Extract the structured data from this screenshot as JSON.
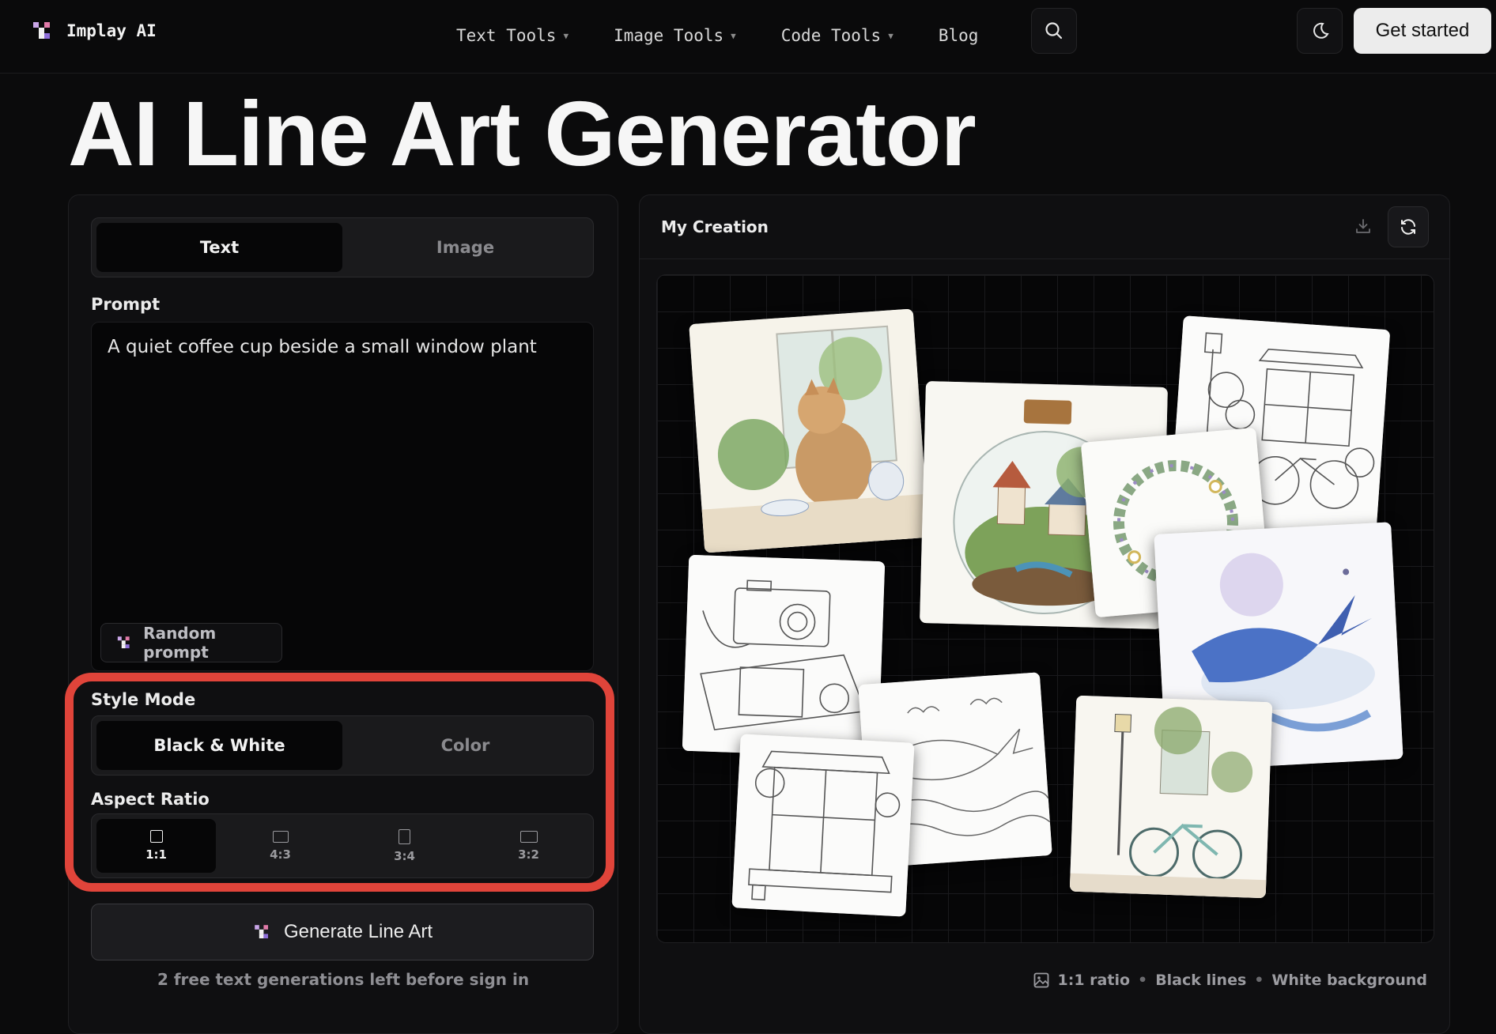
{
  "nav": {
    "brand": "Implay AI",
    "links": [
      {
        "label": "Text Tools",
        "dropdown": true
      },
      {
        "label": "Image Tools",
        "dropdown": true
      },
      {
        "label": "Code Tools",
        "dropdown": true
      },
      {
        "label": "Blog",
        "dropdown": false
      }
    ],
    "cta": "Get started"
  },
  "page": {
    "title": "AI Line Art Generator"
  },
  "input_panel": {
    "tabs": [
      {
        "label": "Text",
        "active": true
      },
      {
        "label": "Image",
        "active": false
      }
    ],
    "prompt_label": "Prompt",
    "prompt_value": "A quiet coffee cup beside a small window plant",
    "random_prompt": "Random prompt",
    "style_mode": {
      "label": "Style Mode",
      "options": [
        {
          "label": "Black & White",
          "active": true
        },
        {
          "label": "Color",
          "active": false
        }
      ]
    },
    "aspect_ratio": {
      "label": "Aspect Ratio",
      "options": [
        {
          "label": "1:1",
          "active": true
        },
        {
          "label": "4:3",
          "active": false
        },
        {
          "label": "3:4",
          "active": false
        },
        {
          "label": "3:2",
          "active": false
        }
      ]
    },
    "generate_button": "Generate Line Art",
    "free_note": "2 free text generations left before sign in",
    "highlight_color": "#e0443a"
  },
  "output_panel": {
    "title": "My Creation",
    "meta": [
      "1:1 ratio",
      "Black lines",
      "White background"
    ]
  }
}
